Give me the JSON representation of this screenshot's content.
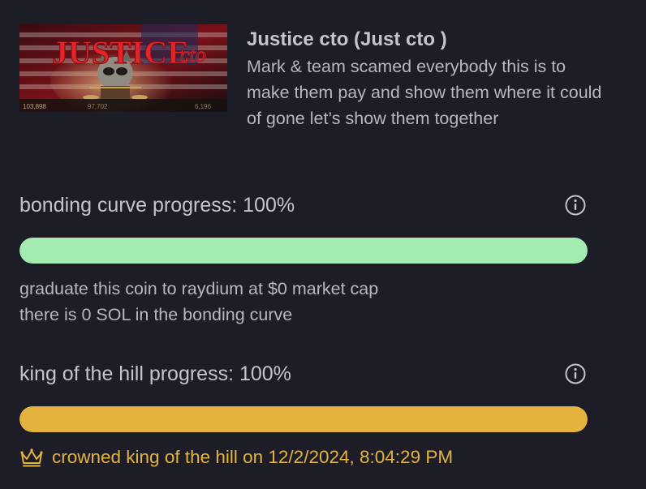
{
  "coin": {
    "title": "Justice cto (Just cto )",
    "description": "Mark & team scamed everybody this is to make them pay and show them where it could of gone let’s show them together",
    "image": {
      "banner_text": "JUSTICE",
      "banner_suffix": "cto",
      "stats": [
        "103,898",
        "97,702",
        "6,196"
      ]
    }
  },
  "bonding": {
    "label": "bonding curve progress: 100%",
    "progress": 1.0,
    "line1": "graduate this coin to raydium at $0 market cap",
    "line2": "there is 0 SOL in the bonding curve"
  },
  "koth": {
    "label": "king of the hill progress: 100%",
    "progress": 1.0,
    "crowned_text": "crowned king of the hill on 12/2/2024, 8:04:29 PM"
  },
  "colors": {
    "background": "#1c1d27",
    "bonding_bar": "#a3ebb1",
    "koth_bar": "#e4b33e",
    "crown_text": "#e4b33e"
  },
  "icons": {
    "info": "info-circle-icon",
    "crown": "crown-icon"
  }
}
